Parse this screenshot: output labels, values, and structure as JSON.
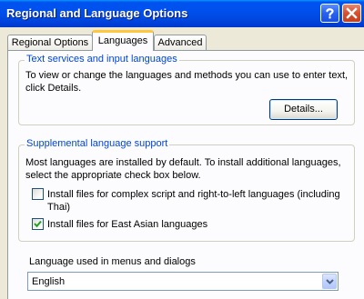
{
  "window": {
    "title": "Regional and Language Options",
    "help_label": "?",
    "close_label": "✕"
  },
  "tabs": [
    {
      "label": "Regional Options",
      "selected": false
    },
    {
      "label": "Languages",
      "selected": true
    },
    {
      "label": "Advanced",
      "selected": false
    }
  ],
  "text_services": {
    "title": "Text services and input languages",
    "description": "To view or change the languages and methods you can use to enter text, click Details.",
    "details_button": "Details..."
  },
  "supplemental": {
    "title": "Supplemental language support",
    "description": "Most languages are installed by default. To install additional languages, select the appropriate check box below.",
    "options": [
      {
        "label": "Install files for complex script and right-to-left languages (including Thai)",
        "checked": false
      },
      {
        "label": "Install files for East Asian languages",
        "checked": true
      }
    ]
  },
  "menus_language": {
    "label": "Language used in menus and dialogs",
    "selected": "English"
  },
  "colors": {
    "titlebar": "#0053ee",
    "group_title": "#0046d5",
    "selected_tab_accent": "#ffc73c",
    "dialog_bg": "#ece9d8"
  },
  "icons": {
    "help": "question-mark-icon",
    "close": "close-icon",
    "check": "checkmark-icon",
    "dropdown": "chevron-down-icon"
  }
}
